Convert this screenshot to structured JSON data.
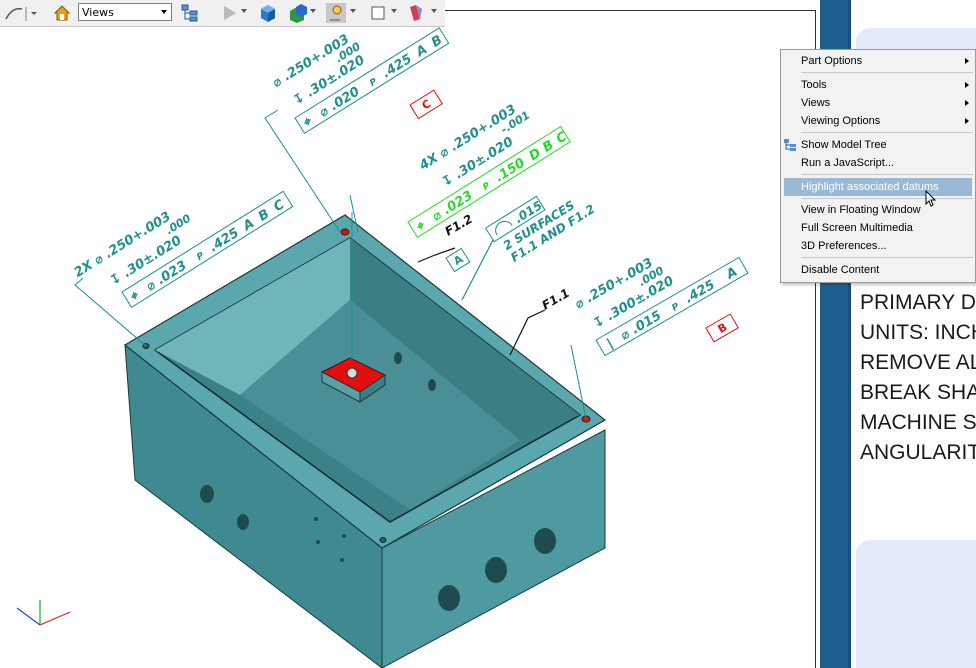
{
  "toolbar": {
    "views_label": "Views",
    "icons": [
      "rotate-tool-icon",
      "home-icon",
      "views-dropdown",
      "model-tree-icon",
      "play-icon",
      "solid-box-icon",
      "box-shade-icon",
      "lighting-icon",
      "background-color-icon",
      "cross-section-icon"
    ]
  },
  "context_menu": {
    "items": [
      {
        "label": "Part Options",
        "submenu": true
      },
      {
        "label": "Tools",
        "submenu": true
      },
      {
        "label": "Views",
        "submenu": true
      },
      {
        "label": "Viewing Options",
        "submenu": true
      },
      {
        "label": "Show Model Tree",
        "submenu": false
      },
      {
        "label": "Run a JavaScript...",
        "submenu": false
      },
      {
        "label": "Highlight associated datums",
        "submenu": false,
        "highlighted": true
      },
      {
        "label": "View in Floating Window",
        "submenu": false
      },
      {
        "label": "Full Screen Multimedia",
        "submenu": false
      },
      {
        "label": "3D Preferences...",
        "submenu": false
      },
      {
        "label": "Disable Content",
        "submenu": false
      }
    ]
  },
  "notes": {
    "lines": [
      "PRIMARY D",
      "UNITS: INCH",
      "REMOVE AL",
      "BREAK SHA",
      "MACHINE S",
      "ANGULARIT"
    ]
  },
  "annotations": {
    "top_hole_dia": "⌀ .250+.003",
    "top_hole_tol": ".000",
    "top_depth": "↧ .30±.020",
    "top_fcf": {
      "sym": "⌖",
      "dia": "⌀ .020",
      "mod": "P",
      "val": ".425",
      "d1": "A",
      "d2": "B"
    },
    "datum_c": "C",
    "four_x_dia": "4X ⌀ .250+.003",
    "four_x_tol": "-.001",
    "four_x_depth": "↧ .30±.020",
    "green_fcf": {
      "sym": "⌖",
      "dia": "⌀ .023",
      "mod": "P",
      "val": ".150",
      "d1": "D",
      "d2": "B",
      "d3": "C"
    },
    "left_dia": "2X ⌀ .250+.003",
    "left_tol": ".000",
    "left_depth": "↧ .30±.020",
    "left_fcf": {
      "sym": "⌖",
      "dia": "⌀ .023",
      "mod": "P",
      "val": ".425",
      "d1": "A",
      "d2": "B",
      "d3": "C"
    },
    "f12": "F1.2",
    "profile_val": ".015",
    "datum_a": "A",
    "surfaces_1": "2 SURFACES",
    "surfaces_2": "F1.1 AND F1.2",
    "f11": "F1.1",
    "right_dia": "⌀ .250+.003",
    "right_tol": ".000",
    "right_depth": "↧ .300±.020",
    "right_fcf": {
      "sym": "|",
      "dia": "⌀ .015",
      "mod": "P",
      "val": ".425",
      "d1": "A"
    },
    "datum_b": "B"
  },
  "colors": {
    "model": "#4f9aa0",
    "annotation": "#1f8f8f",
    "highlight_green": "#22dd22",
    "datum_red": "#e01010",
    "panel_blue": "#1f5f8f",
    "menu_highlight": "#9ab9d6"
  }
}
